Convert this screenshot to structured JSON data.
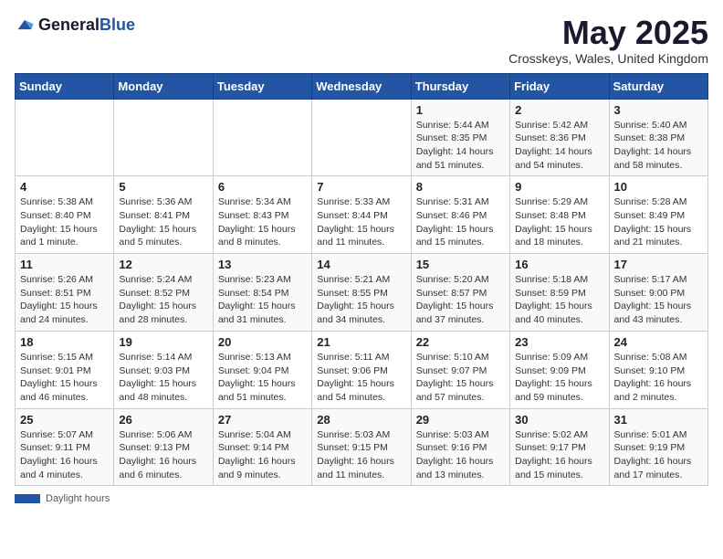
{
  "header": {
    "logo_general": "General",
    "logo_blue": "Blue",
    "title": "May 2025",
    "location": "Crosskeys, Wales, United Kingdom"
  },
  "weekdays": [
    "Sunday",
    "Monday",
    "Tuesday",
    "Wednesday",
    "Thursday",
    "Friday",
    "Saturday"
  ],
  "weeks": [
    [
      {
        "day": "",
        "info": ""
      },
      {
        "day": "",
        "info": ""
      },
      {
        "day": "",
        "info": ""
      },
      {
        "day": "",
        "info": ""
      },
      {
        "day": "1",
        "info": "Sunrise: 5:44 AM\nSunset: 8:35 PM\nDaylight: 14 hours\nand 51 minutes."
      },
      {
        "day": "2",
        "info": "Sunrise: 5:42 AM\nSunset: 8:36 PM\nDaylight: 14 hours\nand 54 minutes."
      },
      {
        "day": "3",
        "info": "Sunrise: 5:40 AM\nSunset: 8:38 PM\nDaylight: 14 hours\nand 58 minutes."
      }
    ],
    [
      {
        "day": "4",
        "info": "Sunrise: 5:38 AM\nSunset: 8:40 PM\nDaylight: 15 hours\nand 1 minute."
      },
      {
        "day": "5",
        "info": "Sunrise: 5:36 AM\nSunset: 8:41 PM\nDaylight: 15 hours\nand 5 minutes."
      },
      {
        "day": "6",
        "info": "Sunrise: 5:34 AM\nSunset: 8:43 PM\nDaylight: 15 hours\nand 8 minutes."
      },
      {
        "day": "7",
        "info": "Sunrise: 5:33 AM\nSunset: 8:44 PM\nDaylight: 15 hours\nand 11 minutes."
      },
      {
        "day": "8",
        "info": "Sunrise: 5:31 AM\nSunset: 8:46 PM\nDaylight: 15 hours\nand 15 minutes."
      },
      {
        "day": "9",
        "info": "Sunrise: 5:29 AM\nSunset: 8:48 PM\nDaylight: 15 hours\nand 18 minutes."
      },
      {
        "day": "10",
        "info": "Sunrise: 5:28 AM\nSunset: 8:49 PM\nDaylight: 15 hours\nand 21 minutes."
      }
    ],
    [
      {
        "day": "11",
        "info": "Sunrise: 5:26 AM\nSunset: 8:51 PM\nDaylight: 15 hours\nand 24 minutes."
      },
      {
        "day": "12",
        "info": "Sunrise: 5:24 AM\nSunset: 8:52 PM\nDaylight: 15 hours\nand 28 minutes."
      },
      {
        "day": "13",
        "info": "Sunrise: 5:23 AM\nSunset: 8:54 PM\nDaylight: 15 hours\nand 31 minutes."
      },
      {
        "day": "14",
        "info": "Sunrise: 5:21 AM\nSunset: 8:55 PM\nDaylight: 15 hours\nand 34 minutes."
      },
      {
        "day": "15",
        "info": "Sunrise: 5:20 AM\nSunset: 8:57 PM\nDaylight: 15 hours\nand 37 minutes."
      },
      {
        "day": "16",
        "info": "Sunrise: 5:18 AM\nSunset: 8:59 PM\nDaylight: 15 hours\nand 40 minutes."
      },
      {
        "day": "17",
        "info": "Sunrise: 5:17 AM\nSunset: 9:00 PM\nDaylight: 15 hours\nand 43 minutes."
      }
    ],
    [
      {
        "day": "18",
        "info": "Sunrise: 5:15 AM\nSunset: 9:01 PM\nDaylight: 15 hours\nand 46 minutes."
      },
      {
        "day": "19",
        "info": "Sunrise: 5:14 AM\nSunset: 9:03 PM\nDaylight: 15 hours\nand 48 minutes."
      },
      {
        "day": "20",
        "info": "Sunrise: 5:13 AM\nSunset: 9:04 PM\nDaylight: 15 hours\nand 51 minutes."
      },
      {
        "day": "21",
        "info": "Sunrise: 5:11 AM\nSunset: 9:06 PM\nDaylight: 15 hours\nand 54 minutes."
      },
      {
        "day": "22",
        "info": "Sunrise: 5:10 AM\nSunset: 9:07 PM\nDaylight: 15 hours\nand 57 minutes."
      },
      {
        "day": "23",
        "info": "Sunrise: 5:09 AM\nSunset: 9:09 PM\nDaylight: 15 hours\nand 59 minutes."
      },
      {
        "day": "24",
        "info": "Sunrise: 5:08 AM\nSunset: 9:10 PM\nDaylight: 16 hours\nand 2 minutes."
      }
    ],
    [
      {
        "day": "25",
        "info": "Sunrise: 5:07 AM\nSunset: 9:11 PM\nDaylight: 16 hours\nand 4 minutes."
      },
      {
        "day": "26",
        "info": "Sunrise: 5:06 AM\nSunset: 9:13 PM\nDaylight: 16 hours\nand 6 minutes."
      },
      {
        "day": "27",
        "info": "Sunrise: 5:04 AM\nSunset: 9:14 PM\nDaylight: 16 hours\nand 9 minutes."
      },
      {
        "day": "28",
        "info": "Sunrise: 5:03 AM\nSunset: 9:15 PM\nDaylight: 16 hours\nand 11 minutes."
      },
      {
        "day": "29",
        "info": "Sunrise: 5:03 AM\nSunset: 9:16 PM\nDaylight: 16 hours\nand 13 minutes."
      },
      {
        "day": "30",
        "info": "Sunrise: 5:02 AM\nSunset: 9:17 PM\nDaylight: 16 hours\nand 15 minutes."
      },
      {
        "day": "31",
        "info": "Sunrise: 5:01 AM\nSunset: 9:19 PM\nDaylight: 16 hours\nand 17 minutes."
      }
    ]
  ],
  "footer": {
    "bar_label": "Daylight hours"
  }
}
